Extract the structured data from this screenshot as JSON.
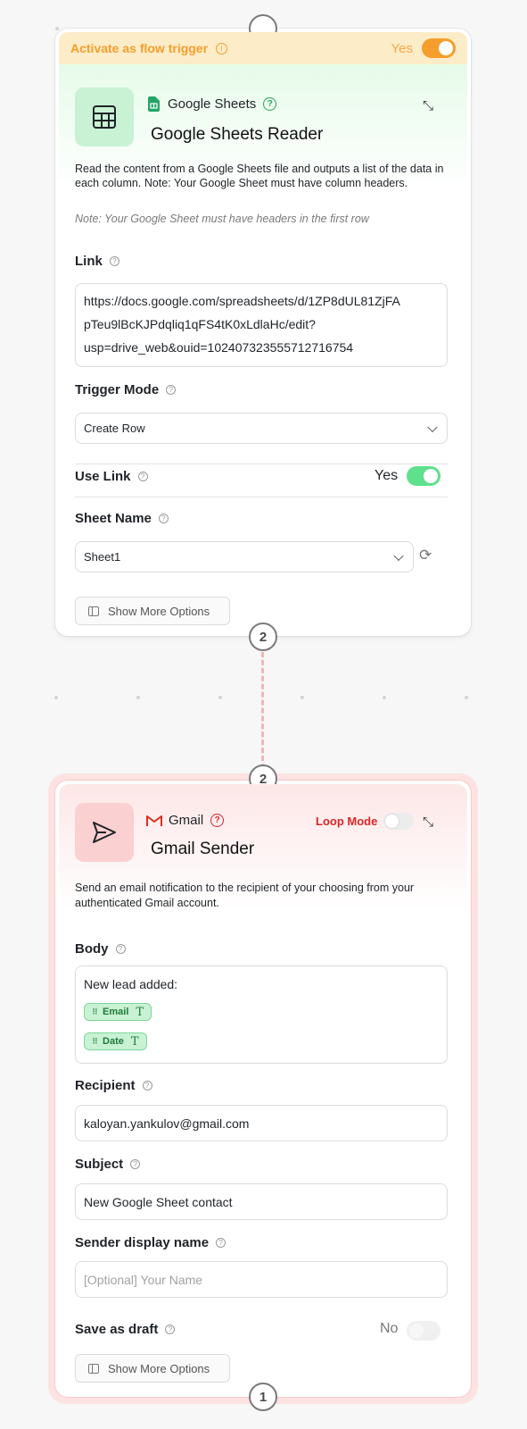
{
  "sheets_node": {
    "trigger_banner": {
      "label": "Activate as flow trigger",
      "value": "Yes"
    },
    "app_name": "Google Sheets",
    "title": "Google Sheets Reader",
    "description": "Read the content from a Google Sheets file and outputs a list of the data in each column. Note: Your Google Sheet must have column headers.",
    "note": "Note: Your Google Sheet must have headers in the first row",
    "link_label": "Link",
    "link_lines": [
      "https://docs.google.com/spreadsheets/d/1ZP8dUL81ZjFA",
      "pTeu9lBcKJPdqliq1qFS4tK0xLdlaHc/edit?",
      "usp=drive_web&ouid=102407323555712716754"
    ],
    "trigger_mode_label": "Trigger Mode",
    "trigger_mode_value": "Create Row",
    "use_link_label": "Use Link",
    "use_link_value": "Yes",
    "sheet_name_label": "Sheet Name",
    "sheet_name_value": "Sheet1",
    "show_more_label": "Show More Options",
    "output_count": "2"
  },
  "gmail_node": {
    "input_count": "2",
    "app_name": "Gmail",
    "loop_mode_label": "Loop Mode",
    "title": "Gmail Sender",
    "description": "Send an email notification to the recipient of your choosing from your authenticated Gmail account.",
    "body_label": "Body",
    "body_text": "New lead added:",
    "body_chips": [
      "Email",
      "Date"
    ],
    "recipient_label": "Recipient",
    "recipient_value": "kaloyan.yankulov@gmail.com",
    "subject_label": "Subject",
    "subject_value": "New Google Sheet contact",
    "sender_label": "Sender display name",
    "sender_placeholder": "[Optional] Your Name",
    "draft_label": "Save as draft",
    "draft_value": "No",
    "show_more_label": "Show More Options",
    "output_count": "1"
  },
  "colors": {
    "trigger_orange": "#f59e2b",
    "sheets_green": "#4ade80",
    "gmail_red": "#dc2626",
    "gmail_border": "#fecaca"
  }
}
